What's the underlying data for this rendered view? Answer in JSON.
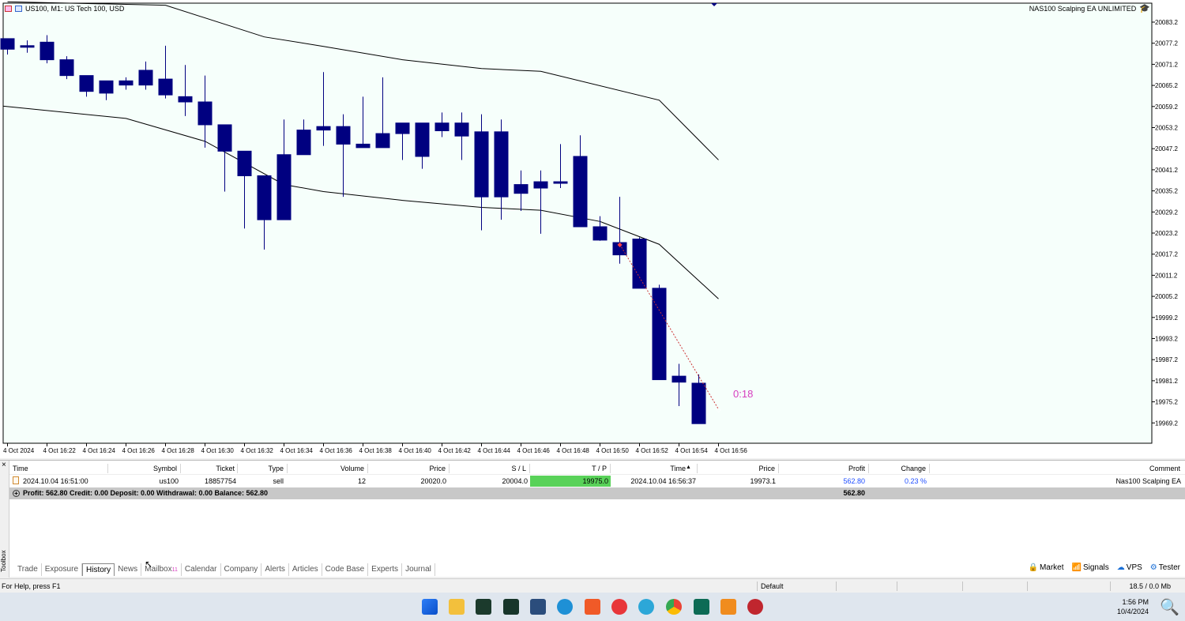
{
  "chart": {
    "symbol_title": "US100, M1:  US Tech 100, USD",
    "ea_name": "NAS100 Scalping EA UNLIMITED",
    "countdown": "0:18",
    "price_labels": [
      "20083.2",
      "20077.2",
      "20071.2",
      "20065.2",
      "20059.2",
      "20053.2",
      "20047.2",
      "20041.2",
      "20035.2",
      "20029.2",
      "20023.2",
      "20017.2",
      "20011.2",
      "20005.2",
      "19999.2",
      "19993.2",
      "19987.2",
      "19981.2",
      "19975.2",
      "19969.2"
    ],
    "time_labels": [
      "4 Oct 2024",
      "4 Oct 16:22",
      "4 Oct 16:24",
      "4 Oct 16:26",
      "4 Oct 16:28",
      "4 Oct 16:30",
      "4 Oct 16:32",
      "4 Oct 16:34",
      "4 Oct 16:36",
      "4 Oct 16:38",
      "4 Oct 16:40",
      "4 Oct 16:42",
      "4 Oct 16:44",
      "4 Oct 16:46",
      "4 Oct 16:48",
      "4 Oct 16:50",
      "4 Oct 16:52",
      "4 Oct 16:54",
      "4 Oct 16:56"
    ],
    "colors": {
      "candle": "#000080",
      "background": "#f6fffb",
      "band": "#000000",
      "countdown": "#d63dbf"
    }
  },
  "chart_data": {
    "type": "candlestick",
    "x": [
      "16:20",
      "16:21",
      "16:22",
      "16:23",
      "16:24",
      "16:25",
      "16:26",
      "16:27",
      "16:28",
      "16:29",
      "16:30",
      "16:31",
      "16:32",
      "16:33",
      "16:34",
      "16:35",
      "16:36",
      "16:37",
      "16:38",
      "16:39",
      "16:40",
      "16:41",
      "16:42",
      "16:43",
      "16:44",
      "16:45",
      "16:46",
      "16:47",
      "16:48",
      "16:49",
      "16:50",
      "16:51",
      "16:52",
      "16:53",
      "16:54",
      "16:55",
      "16:56"
    ],
    "open": [
      20078.5,
      20076.5,
      20077.5,
      20072.5,
      20068.0,
      20063.0,
      20066.5,
      20065.3,
      20067.0,
      20062.0,
      20060.5,
      20054.0,
      20046.5,
      20039.5,
      20027.0,
      20045.5,
      20052.5,
      20053.5,
      20048.5,
      20047.5,
      20051.5,
      20054.5,
      20052.3,
      20054.5,
      20052.0,
      20033.5,
      20037.0,
      20036.0,
      20037.8,
      20045.0,
      20025.0,
      20020.5,
      20021.5,
      20007.5,
      19982.5,
      19980.5
    ],
    "close": [
      20075.5,
      20076.5,
      20072.5,
      20068.0,
      20063.5,
      20066.5,
      20065.3,
      20069.5,
      20062.5,
      20060.5,
      20054.0,
      20046.5,
      20039.5,
      20027.0,
      20045.5,
      20052.5,
      20053.5,
      20048.5,
      20047.5,
      20051.5,
      20054.5,
      20045.0,
      20054.5,
      20050.8,
      20033.5,
      20052.0,
      20034.5,
      20037.8,
      20037.8,
      20025.0,
      20021.2,
      20017.0,
      20007.5,
      19981.5,
      19980.8,
      19969.0
    ],
    "high": [
      20078.5,
      20078.0,
      20079.5,
      20073.5,
      20068.0,
      20065.0,
      20067.5,
      20072.0,
      20076.5,
      20071.0,
      20068.0,
      20054.0,
      20046.5,
      20038.0,
      20055.5,
      20055.5,
      20069.0,
      20057.0,
      20062.0,
      20067.5,
      20054.5,
      20054.5,
      20057.5,
      20057.5,
      20057.0,
      20055.5,
      20041.0,
      20041.0,
      20048.5,
      20051.0,
      20028.0,
      20033.5,
      20022.0,
      20008.5,
      19986.0,
      19983.0
    ],
    "low": [
      20074.0,
      20074.5,
      20071.5,
      20067.0,
      20062.0,
      20061.0,
      20064.0,
      20064.0,
      20061.5,
      20056.5,
      20047.5,
      20035.0,
      20024.5,
      20018.5,
      20027.0,
      20045.5,
      20048.0,
      20033.5,
      20048.0,
      20050.0,
      20044.0,
      20041.5,
      20050.5,
      20044.0,
      20024.0,
      20027.0,
      20029.5,
      20023.0,
      20036.0,
      20043.0,
      20021.0,
      20014.5,
      20012.0,
      20003.0,
      19974.0,
      19973.5
    ],
    "upper_band": {
      "x": [
        0,
        8,
        13,
        16,
        20,
        24,
        27,
        33,
        36
      ],
      "y": [
        20089.0,
        20088.0,
        20079.0,
        20076.3,
        20072.5,
        20070.0,
        20069.2,
        20061.0,
        20044.0
      ]
    },
    "lower_band": {
      "x": [
        -0.2,
        6,
        10,
        14,
        16,
        20,
        24,
        27,
        30,
        33,
        36
      ],
      "y": [
        20059.3,
        20055.8,
        20049.3,
        20037.0,
        20035.0,
        20032.5,
        20030.5,
        20029.7,
        20026.5,
        20020.0,
        20004.5
      ]
    },
    "ylim": [
      19966.5,
      20088.6
    ]
  },
  "history": {
    "columns": [
      "Time",
      "Symbol",
      "Ticket",
      "Type",
      "Volume",
      "Price",
      "S / L",
      "T / P",
      "Time",
      "Price",
      "Profit",
      "Change",
      "Comment"
    ],
    "row": {
      "time": "2024.10.04 16:51:00",
      "symbol": "us100",
      "ticket": "18857754",
      "type": "sell",
      "volume": "12",
      "price": "20020.0",
      "sl": "20004.0",
      "tp": "19975.0",
      "close_time": "2024.10.04 16:56:37",
      "close_price": "19973.1",
      "profit": "562.80",
      "change": "0.23 %",
      "comment": "Nas100 Scalping EA"
    },
    "summary": {
      "label": "Profit: 562.80  Credit: 0.00  Deposit: 0.00  Withdrawal: 0.00  Balance: 562.80",
      "total": "562.80"
    }
  },
  "toolbox": {
    "label": "Toolbox",
    "close": "×",
    "tabs": [
      "Trade",
      "Exposure",
      "History",
      "News",
      "Mailbox",
      "Calendar",
      "Company",
      "Alerts",
      "Articles",
      "Code Base",
      "Experts",
      "Journal"
    ],
    "mailbox_badge": "11",
    "active_tab": "History",
    "right_links": [
      "Market",
      "Signals",
      "VPS",
      "Tester"
    ]
  },
  "statusbar": {
    "help": "For Help, press F1",
    "profile": "Default",
    "traffic": "18.5 / 0.0 Mb"
  },
  "taskbar": {
    "time": "1:56 PM",
    "date": "10/4/2024"
  }
}
